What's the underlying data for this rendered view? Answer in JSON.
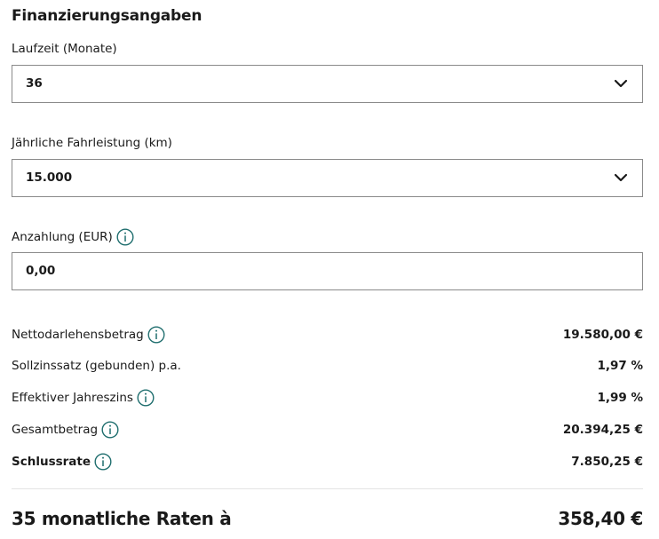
{
  "section": {
    "title": "Finanzierungsangaben"
  },
  "fields": {
    "laufzeit": {
      "label": "Laufzeit (Monate)",
      "value": "36"
    },
    "fahrleistung": {
      "label": "Jährliche Fahrleistung (km)",
      "value": "15.000"
    },
    "anzahlung": {
      "label": "Anzahlung (EUR)",
      "value": "0,00"
    }
  },
  "summary": {
    "rows": [
      {
        "label": "Nettodarlehensbetrag",
        "value": "19.580,00 €"
      },
      {
        "label": "Sollzinssatz (gebunden) p.a.",
        "value": "1,97 %"
      },
      {
        "label": "Effektiver Jahreszins",
        "value": "1,99 %"
      },
      {
        "label": "Gesamtbetrag",
        "value": "20.394,25 €"
      },
      {
        "label": "Schlussrate",
        "value": "7.850,25 €"
      }
    ],
    "total": {
      "label": "35 monatliche Raten à",
      "value": "358,40 €"
    }
  },
  "colors": {
    "info_icon": "#1f6e6e",
    "border": "#8a8a8a",
    "divider": "#e3e3e3",
    "text": "#1a1a1a"
  },
  "icons": {
    "dropdown": "chevron-down-icon",
    "info": "info-icon"
  }
}
